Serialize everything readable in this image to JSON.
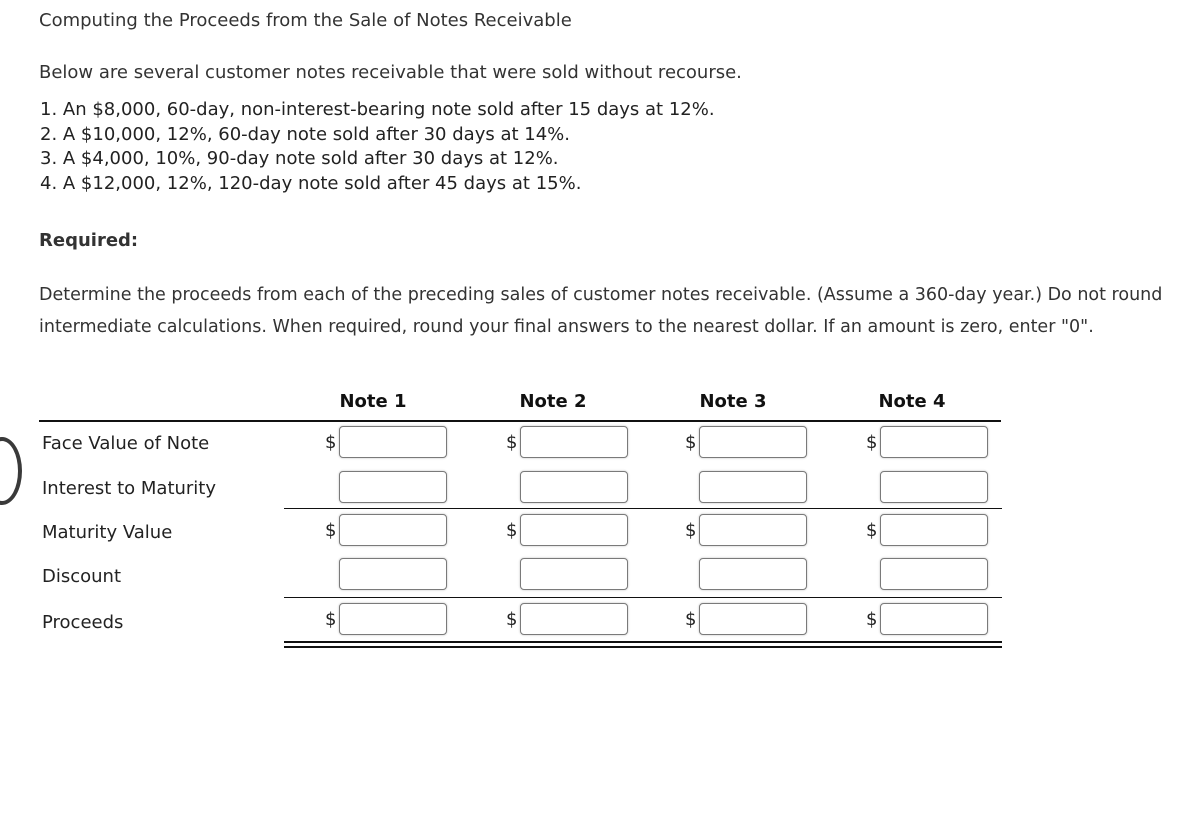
{
  "title": "Computing the Proceeds from the Sale of Notes Receivable",
  "intro": "Below are several customer notes receivable that were sold without recourse.",
  "items": [
    "1. An $8,000, 60-day, non-interest-bearing note sold after 15 days at 12%.",
    "2. A $10,000, 12%, 60-day note sold after 30 days at 14%.",
    "3. A $4,000, 10%, 90-day note sold after 30 days at 12%.",
    "4. A $12,000, 12%, 120-day note sold after 45 days at 15%."
  ],
  "required_label": "Required:",
  "instructions": "Determine the proceeds from each of the preceding sales of customer notes receivable. (Assume a 360-day year.) Do not round intermediate calculations. When required, round your final answers to the nearest dollar. If an amount is zero, enter \"0\".",
  "table": {
    "columns": [
      "Note 1",
      "Note 2",
      "Note 3",
      "Note 4"
    ],
    "currency_symbol": "$",
    "rows": [
      {
        "label": "Face Value of Note",
        "has_dollar": true,
        "values": [
          "",
          "",
          "",
          ""
        ]
      },
      {
        "label": "Interest to Maturity",
        "has_dollar": false,
        "values": [
          "",
          "",
          "",
          ""
        ]
      },
      {
        "label": "Maturity Value",
        "has_dollar": true,
        "values": [
          "",
          "",
          "",
          ""
        ]
      },
      {
        "label": "Discount",
        "has_dollar": false,
        "values": [
          "",
          "",
          "",
          ""
        ]
      },
      {
        "label": "Proceeds",
        "has_dollar": true,
        "values": [
          "",
          "",
          "",
          ""
        ]
      }
    ]
  }
}
